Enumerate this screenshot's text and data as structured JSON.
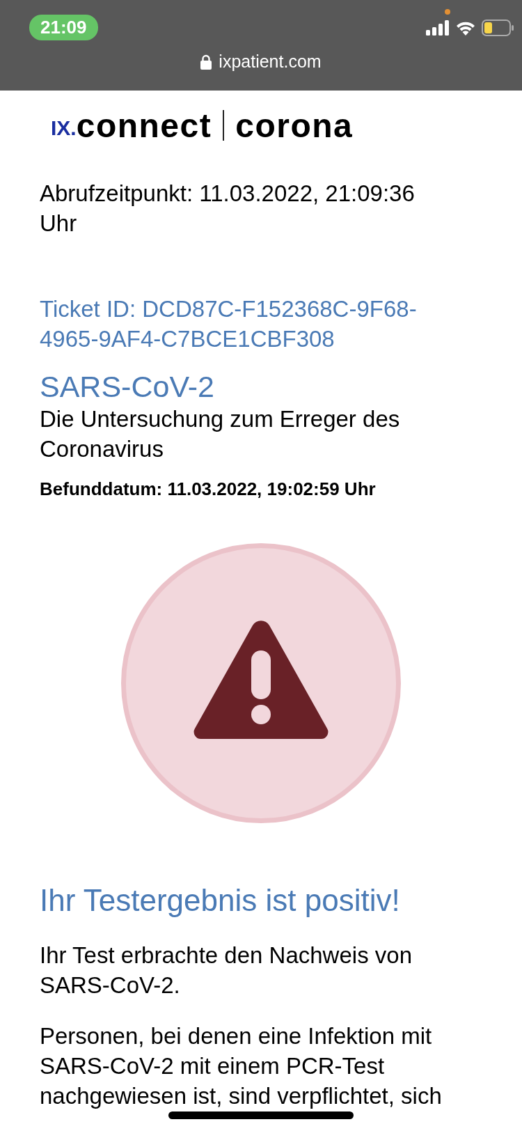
{
  "status_bar": {
    "time": "21:09",
    "url": "ixpatient.com"
  },
  "logo": {
    "prefix": "IX.",
    "brand": "connect",
    "product": "corona"
  },
  "retrieved": "Abrufzeitpunkt: 11.03.2022, 21:09:36 Uhr",
  "ticket": "Ticket ID: DCD87C-F152368C-9F68-4965-9AF4-C7BCE1CBF308",
  "test": {
    "title": "SARS-CoV-2",
    "subtitle": "Die Untersuchung zum Erreger des Coronavirus",
    "date": "Befunddatum: 11.03.2022, 19:02:59 Uhr"
  },
  "result": {
    "kind": "positive",
    "heading": "Ihr Testergebnis ist positiv!",
    "paragraphs": [
      "Ihr Test erbrachte den Nachweis von SARS-CoV-2.",
      "Personen, bei denen eine Infektion mit SARS-CoV-2 mit einem PCR-Test nachgewiesen ist, sind verpflichtet, sich"
    ]
  }
}
